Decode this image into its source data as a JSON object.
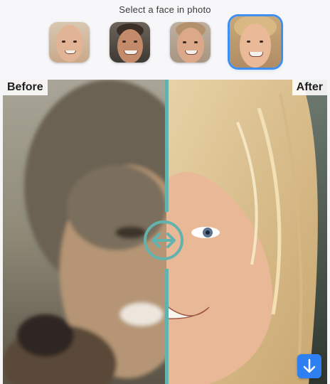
{
  "header": {
    "title": "Select a face in photo"
  },
  "faces": [
    {
      "name": "face-1",
      "selected": false
    },
    {
      "name": "face-2",
      "selected": false
    },
    {
      "name": "face-3",
      "selected": false
    },
    {
      "name": "face-4",
      "selected": true
    }
  ],
  "comparison": {
    "before_label": "Before",
    "after_label": "After"
  },
  "icons": {
    "divider_handle": "left-right-arrows-icon",
    "download": "download-arrow-icon"
  },
  "colors": {
    "divider": "#62b3ad",
    "selected_ring": "#3f8ff0",
    "download_button": "#2d7ff2"
  }
}
